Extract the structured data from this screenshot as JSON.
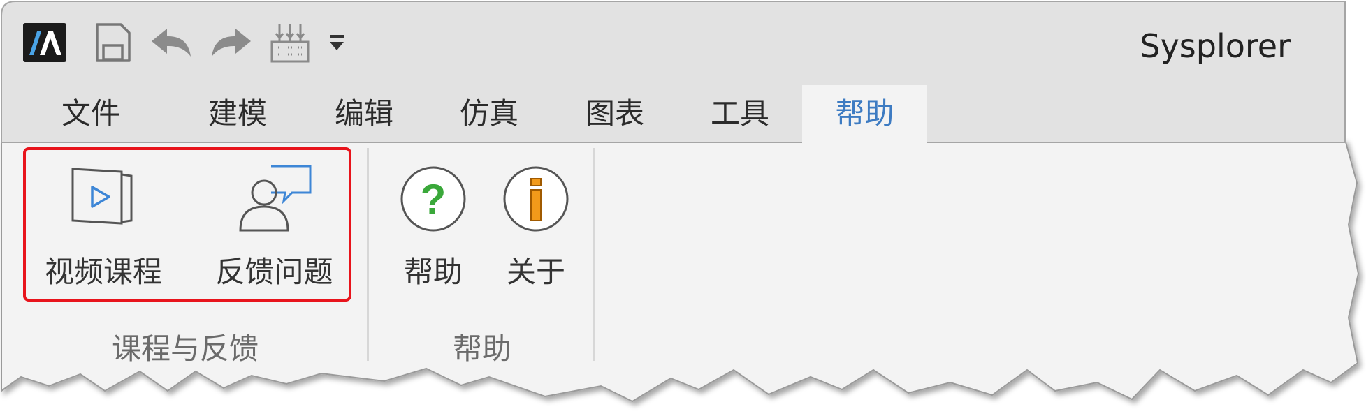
{
  "window": {
    "title": "Sysplorer"
  },
  "quick_access": {
    "icons": [
      "app-logo-icon",
      "save-icon",
      "undo-icon",
      "redo-icon",
      "model-grid-icon",
      "customize-toolbar-icon"
    ]
  },
  "tabs": [
    {
      "label": "文件"
    },
    {
      "label": "建模"
    },
    {
      "label": "编辑"
    },
    {
      "label": "仿真"
    },
    {
      "label": "图表"
    },
    {
      "label": "工具"
    },
    {
      "label": "帮助",
      "active": true
    }
  ],
  "groups": [
    {
      "label": "课程与反馈",
      "highlighted": true,
      "buttons": [
        {
          "label": "视频课程",
          "icon": "video-course-icon"
        },
        {
          "label": "反馈问题",
          "icon": "feedback-icon"
        }
      ]
    },
    {
      "label": "帮助",
      "buttons": [
        {
          "label": "帮助",
          "icon": "help-icon"
        },
        {
          "label": "关于",
          "icon": "about-icon"
        }
      ]
    }
  ],
  "colors": {
    "titlebar_bg": "#e2e2e2",
    "ribbon_bg": "#f3f3f3",
    "active_tab_text": "#3d7bc2",
    "highlight_border": "#e8141c",
    "help_icon_green": "#3aa83a",
    "about_icon_orange": "#f29a1a"
  }
}
